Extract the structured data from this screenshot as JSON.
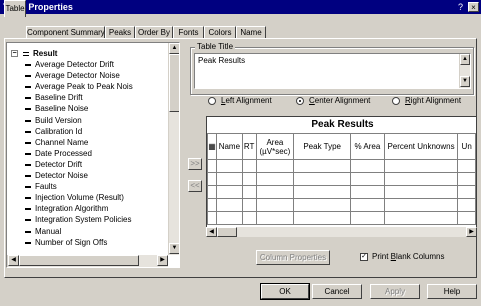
{
  "window": {
    "title": "Table Properties",
    "help_glyph": "?",
    "close_glyph": "×"
  },
  "tabs": [
    "Table",
    "Component Summary",
    "Peaks",
    "Order By",
    "Fonts",
    "Colors",
    "Name"
  ],
  "active_tab": 0,
  "tree": {
    "root_label": "Result",
    "expand_glyph": "−",
    "items": [
      "Average Detector Drift",
      "Average Detector Noise",
      "Average Peak to Peak Nois",
      "Baseline Drift",
      "Baseline Noise",
      "Build Version",
      "Calibration Id",
      "Channel Name",
      "Date Processed",
      "Detector Drift",
      "Detector Noise",
      "Faults",
      "Injection Volume (Result)",
      "Integration Algorithm",
      "Integration System Policies",
      "Manual",
      "Number of Sign Offs"
    ]
  },
  "table_title": {
    "group_label": "Table Title",
    "value": "Peak Results"
  },
  "alignment": {
    "options": [
      {
        "pre": "",
        "key": "L",
        "rest": "eft Alignment",
        "selected": false
      },
      {
        "pre": "",
        "key": "C",
        "rest": "enter Alignment",
        "selected": true
      },
      {
        "pre": "",
        "key": "R",
        "rest": "ight Alignment",
        "selected": false
      }
    ]
  },
  "move_buttons": {
    "add": ">>",
    "remove": "<<"
  },
  "grid": {
    "title": "Peak Results",
    "columns": [
      "",
      "Name",
      "RT",
      "Area\n(µV*sec)",
      "Peak Type",
      "% Area",
      "Percent Unknowns",
      "Un"
    ]
  },
  "column_properties_label": "Column Properties",
  "print_blank": {
    "key": "B",
    "pre": "Print ",
    "rest": "lank Columns",
    "checked": true
  },
  "footer": {
    "ok": "OK",
    "cancel": "Cancel",
    "apply": "Apply",
    "help": "Help"
  }
}
